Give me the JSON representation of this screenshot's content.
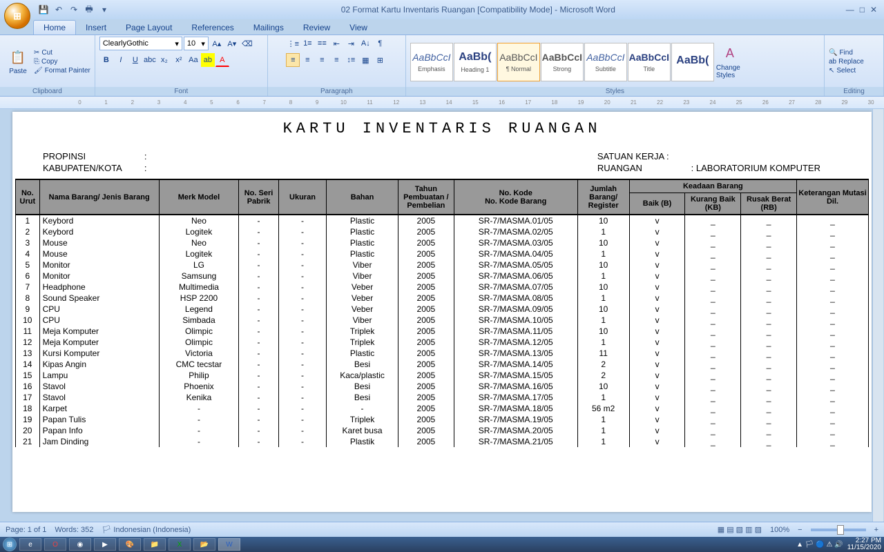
{
  "window": {
    "title": "02 Format Kartu Inventaris Ruangan [Compatibility Mode] - Microsoft Word"
  },
  "tabs": [
    "Home",
    "Insert",
    "Page Layout",
    "References",
    "Mailings",
    "Review",
    "View"
  ],
  "clipboard": {
    "cut": "Cut",
    "copy": "Copy",
    "fmtpainter": "Format Painter",
    "paste": "Paste",
    "label": "Clipboard"
  },
  "font": {
    "name": "ClearlyGothic",
    "size": "10",
    "label": "Font"
  },
  "para": {
    "label": "Paragraph"
  },
  "styles": {
    "label": "Styles",
    "items": [
      {
        "prev": "AaBbCcI",
        "name": "Emphasis"
      },
      {
        "prev": "AaBb(",
        "name": "Heading 1"
      },
      {
        "prev": "AaBbCcI",
        "name": "¶ Normal"
      },
      {
        "prev": "AaBbCcI",
        "name": "Strong"
      },
      {
        "prev": "AaBbCcI",
        "name": "Subtitle"
      },
      {
        "prev": "AaBbCcI",
        "name": "Title"
      },
      {
        "prev": "AaBb(",
        "name": ""
      }
    ],
    "change": "Change Styles"
  },
  "editing": {
    "find": "Find",
    "replace": "Replace",
    "select": "Select",
    "label": "Editing"
  },
  "doc": {
    "title": "KARTU INVENTARIS RUANGAN",
    "propinsi_l": "PROPINSI",
    "kabkota_l": "KABUPATEN/KOTA",
    "satuan_l": "SATUAN KERJA :",
    "ruangan_l": "RUANGAN",
    "ruangan_v": ": LABORATORIUM KOMPUTER",
    "headers": {
      "no": "No. Urut",
      "nama": "Nama Barang/ Jenis Barang",
      "merk": "Merk Model",
      "seri": "No. Seri Pabrik",
      "ukuran": "Ukuran",
      "bahan": "Bahan",
      "tahun": "Tahun Pembuatan / Pembelian",
      "kode": "No. Kode\nNo. Kode Barang",
      "jml": "Jumlah Barang/ Register",
      "keadaan": "Keadaan Barang",
      "baik": "Baik (B)",
      "kb": "Kurang Baik (KB)",
      "rb": "Rusak Berat (RB)",
      "ket": "Keterangan Mutasi Dil."
    },
    "rows": [
      {
        "no": 1,
        "nama": "Keybord",
        "merk": "Neo",
        "seri": "-",
        "uk": "-",
        "bahan": "Plastic",
        "th": "2005",
        "kode": "SR-7/MASMA.01/05",
        "jml": "10",
        "b": "v",
        "kb": "_",
        "rb": "_",
        "ket": "_"
      },
      {
        "no": 2,
        "nama": "Keybord",
        "merk": "Logitek",
        "seri": "-",
        "uk": "-",
        "bahan": "Plastic",
        "th": "2005",
        "kode": "SR-7/MASMA.02/05",
        "jml": "1",
        "b": "v",
        "kb": "_",
        "rb": "_",
        "ket": "_"
      },
      {
        "no": 3,
        "nama": "Mouse",
        "merk": "Neo",
        "seri": "-",
        "uk": "-",
        "bahan": "Plastic",
        "th": "2005",
        "kode": "SR-7/MASMA.03/05",
        "jml": "10",
        "b": "v",
        "kb": "_",
        "rb": "_",
        "ket": "_"
      },
      {
        "no": 4,
        "nama": "Mouse",
        "merk": "Logitek",
        "seri": "-",
        "uk": "-",
        "bahan": "Plastic",
        "th": "2005",
        "kode": "SR-7/MASMA.04/05",
        "jml": "1",
        "b": "v",
        "kb": "_",
        "rb": "_",
        "ket": "_"
      },
      {
        "no": 5,
        "nama": "Monitor",
        "merk": "LG",
        "seri": "-",
        "uk": "-",
        "bahan": "Viber",
        "th": "2005",
        "kode": "SR-7/MASMA.05/05",
        "jml": "10",
        "b": "v",
        "kb": "_",
        "rb": "_",
        "ket": "_"
      },
      {
        "no": 6,
        "nama": "Monitor",
        "merk": "Samsung",
        "seri": "-",
        "uk": "-",
        "bahan": "Viber",
        "th": "2005",
        "kode": "SR-7/MASMA.06/05",
        "jml": "1",
        "b": "v",
        "kb": "_",
        "rb": "_",
        "ket": "_"
      },
      {
        "no": 7,
        "nama": "Headphone",
        "merk": "Multimedia",
        "seri": "-",
        "uk": "-",
        "bahan": "Veber",
        "th": "2005",
        "kode": "SR-7/MASMA.07/05",
        "jml": "10",
        "b": "v",
        "kb": "_",
        "rb": "_",
        "ket": "_"
      },
      {
        "no": 8,
        "nama": "Sound Speaker",
        "merk": "HSP 2200",
        "seri": "-",
        "uk": "-",
        "bahan": "Veber",
        "th": "2005",
        "kode": "SR-7/MASMA.08/05",
        "jml": "1",
        "b": "v",
        "kb": "_",
        "rb": "_",
        "ket": "_"
      },
      {
        "no": 9,
        "nama": "CPU",
        "merk": "Legend",
        "seri": "-",
        "uk": "-",
        "bahan": "Veber",
        "th": "2005",
        "kode": "SR-7/MASMA.09/05",
        "jml": "10",
        "b": "v",
        "kb": "_",
        "rb": "_",
        "ket": "_"
      },
      {
        "no": 10,
        "nama": "CPU",
        "merk": "Simbada",
        "seri": "-",
        "uk": "-",
        "bahan": "Viber",
        "th": "2005",
        "kode": "SR-7/MASMA.10/05",
        "jml": "1",
        "b": "v",
        "kb": "_",
        "rb": "_",
        "ket": "_"
      },
      {
        "no": 11,
        "nama": "Meja Komputer",
        "merk": "Olimpic",
        "seri": "-",
        "uk": "-",
        "bahan": "Triplek",
        "th": "2005",
        "kode": "SR-7/MASMA.11/05",
        "jml": "10",
        "b": "v",
        "kb": "_",
        "rb": "_",
        "ket": "_"
      },
      {
        "no": 12,
        "nama": "Meja Komputer",
        "merk": "Olimpic",
        "seri": "-",
        "uk": "-",
        "bahan": "Triplek",
        "th": "2005",
        "kode": "SR-7/MASMA.12/05",
        "jml": "1",
        "b": "v",
        "kb": "_",
        "rb": "_",
        "ket": "_"
      },
      {
        "no": 13,
        "nama": "Kursi Komputer",
        "merk": "Victoria",
        "seri": "-",
        "uk": "-",
        "bahan": "Plastic",
        "th": "2005",
        "kode": "SR-7/MASMA.13/05",
        "jml": "11",
        "b": "v",
        "kb": "_",
        "rb": "_",
        "ket": "_"
      },
      {
        "no": 14,
        "nama": "Kipas Angin",
        "merk": "CMC tecstar",
        "seri": "-",
        "uk": "-",
        "bahan": "Besi",
        "th": "2005",
        "kode": "SR-7/MASMA.14/05",
        "jml": "2",
        "b": "v",
        "kb": "_",
        "rb": "_",
        "ket": "_"
      },
      {
        "no": 15,
        "nama": "Lampu",
        "merk": "Philip",
        "seri": "-",
        "uk": "-",
        "bahan": "Kaca/plastic",
        "th": "2005",
        "kode": "SR-7/MASMA.15/05",
        "jml": "2",
        "b": "v",
        "kb": "_",
        "rb": "_",
        "ket": "_"
      },
      {
        "no": 16,
        "nama": "Stavol",
        "merk": "Phoenix",
        "seri": "-",
        "uk": "-",
        "bahan": "Besi",
        "th": "2005",
        "kode": "SR-7/MASMA.16/05",
        "jml": "10",
        "b": "v",
        "kb": "_",
        "rb": "_",
        "ket": "_"
      },
      {
        "no": 17,
        "nama": "Stavol",
        "merk": "Kenika",
        "seri": "-",
        "uk": "-",
        "bahan": "Besi",
        "th": "2005",
        "kode": "SR-7/MASMA.17/05",
        "jml": "1",
        "b": "v",
        "kb": "_",
        "rb": "_",
        "ket": "_"
      },
      {
        "no": 18,
        "nama": "Karpet",
        "merk": "-",
        "seri": "-",
        "uk": "-",
        "bahan": "-",
        "th": "2005",
        "kode": "SR-7/MASMA.18/05",
        "jml": "56 m2",
        "b": "v",
        "kb": "_",
        "rb": "_",
        "ket": "_"
      },
      {
        "no": 19,
        "nama": "Papan Tulis",
        "merk": "-",
        "seri": "-",
        "uk": "-",
        "bahan": "Triplek",
        "th": "2005",
        "kode": "SR-7/MASMA.19/05",
        "jml": "1",
        "b": "v",
        "kb": "_",
        "rb": "_",
        "ket": "_"
      },
      {
        "no": 20,
        "nama": "Papan Info",
        "merk": "-",
        "seri": "-",
        "uk": "-",
        "bahan": "Karet busa",
        "th": "2005",
        "kode": "SR-7/MASMA.20/05",
        "jml": "1",
        "b": "v",
        "kb": "_",
        "rb": "_",
        "ket": "_"
      },
      {
        "no": 21,
        "nama": "Jam Dinding",
        "merk": "-",
        "seri": "-",
        "uk": "-",
        "bahan": "Plastik",
        "th": "2005",
        "kode": "SR-7/MASMA.21/05",
        "jml": "1",
        "b": "v",
        "kb": "_",
        "rb": "_",
        "ket": "_"
      }
    ]
  },
  "status": {
    "page": "Page: 1 of 1",
    "words": "Words: 352",
    "lang": "Indonesian (Indonesia)",
    "zoom": "100%"
  },
  "tb_time": "2:27 PM",
  "tb_date": "11/15/2020"
}
